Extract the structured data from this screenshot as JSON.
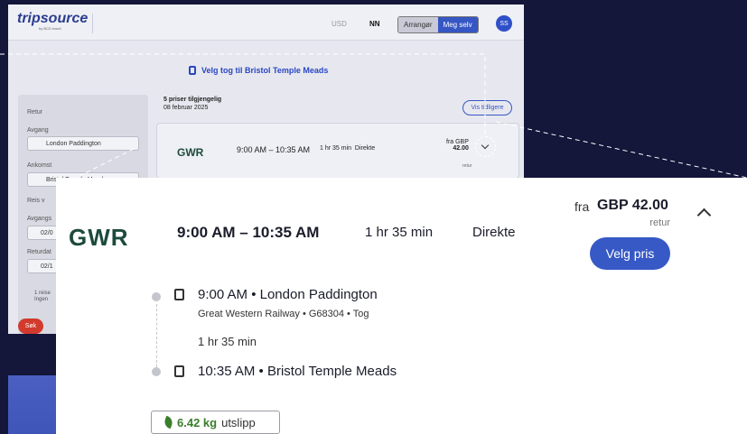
{
  "header": {
    "logo": "tripsource",
    "logo_sub": "by BCD travel",
    "currency": "USD",
    "language": "NN",
    "mode_options": [
      "Arrangør",
      "Meg selv"
    ],
    "avatar_initials": "SS"
  },
  "search_title": "Velg tog til Bristol Temple Meads",
  "sidebar": {
    "trip_type": "Retur",
    "departure_label": "Avgang",
    "departure_value": "London Paddington",
    "arrival_label": "Ankomst",
    "arrival_value": "Bristol Temple Meads",
    "travel_option": "Reis v",
    "outbound_date_label": "Avgangs",
    "outbound_date_value": "02/0",
    "return_date_label": "Returdat",
    "return_date_value": "02/1",
    "passengers_line1": "1 reise",
    "passengers_line2": "Ingen",
    "search_button": "Søk"
  },
  "results": {
    "count_text": "5 priser tilgjengelig",
    "date": "08 februar 2025",
    "earlier_button": "Vis tidligere"
  },
  "mini_row": {
    "operator": "GWR",
    "times": "9:00 AM – 10:35 AM",
    "duration": "1 hr 35 min",
    "type": "Direkte",
    "price_prefix": "fra GBP",
    "price": "42.00",
    "price_suffix": "retur"
  },
  "card": {
    "operator_logo": "GWR",
    "times": "9:00 AM – 10:35 AM",
    "duration": "1 hr 35 min",
    "type": "Direkte",
    "price_prefix": "fra",
    "price": "GBP 42.00",
    "price_suffix": "retur",
    "select_button": "Velg pris",
    "departure": "9:00 AM • London Paddington",
    "service": "Great Western Railway • G68304 • Tog",
    "travel_time": "1 hr 35 min",
    "arrival": "10:35 AM • Bristol Temple Meads",
    "emission_value": "6.42 kg",
    "emission_label": "utslipp"
  }
}
